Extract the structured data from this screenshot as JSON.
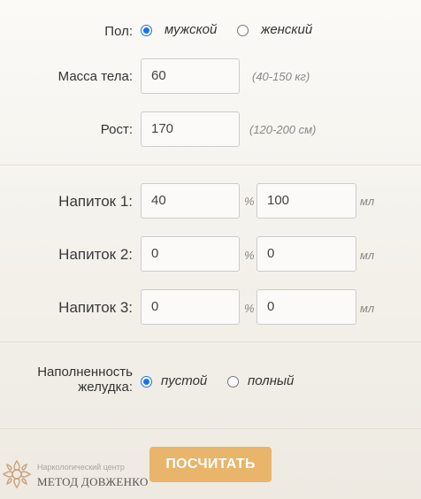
{
  "gender": {
    "label": "Пол:",
    "options": [
      {
        "label": "мужской",
        "checked": true
      },
      {
        "label": "женский",
        "checked": false
      }
    ]
  },
  "weight": {
    "label": "Масса тела:",
    "value": "60",
    "hint": "(40-150 кг)"
  },
  "height": {
    "label": "Рост:",
    "value": "170",
    "hint": "(120-200 см)"
  },
  "drinks": [
    {
      "label": "Напиток 1:",
      "percent": "40",
      "volume": "100"
    },
    {
      "label": "Напиток 2:",
      "percent": "0",
      "volume": "0"
    },
    {
      "label": "Напиток 3:",
      "percent": "0",
      "volume": "0"
    }
  ],
  "units": {
    "percent": "%",
    "volume": "мл"
  },
  "stomach": {
    "label_line1": "Наполненность",
    "label_line2": "желудка:",
    "options": [
      {
        "label": "пустой",
        "checked": true
      },
      {
        "label": "полный",
        "checked": false
      }
    ]
  },
  "calculate_button": "ПОСЧИТАТЬ",
  "logo": {
    "small": "Наркологический центр",
    "big": "МЕТОД ДОВЖЕНКО"
  },
  "colors": {
    "accent_button": "#e8b56a",
    "radio": "#1a73e8"
  }
}
